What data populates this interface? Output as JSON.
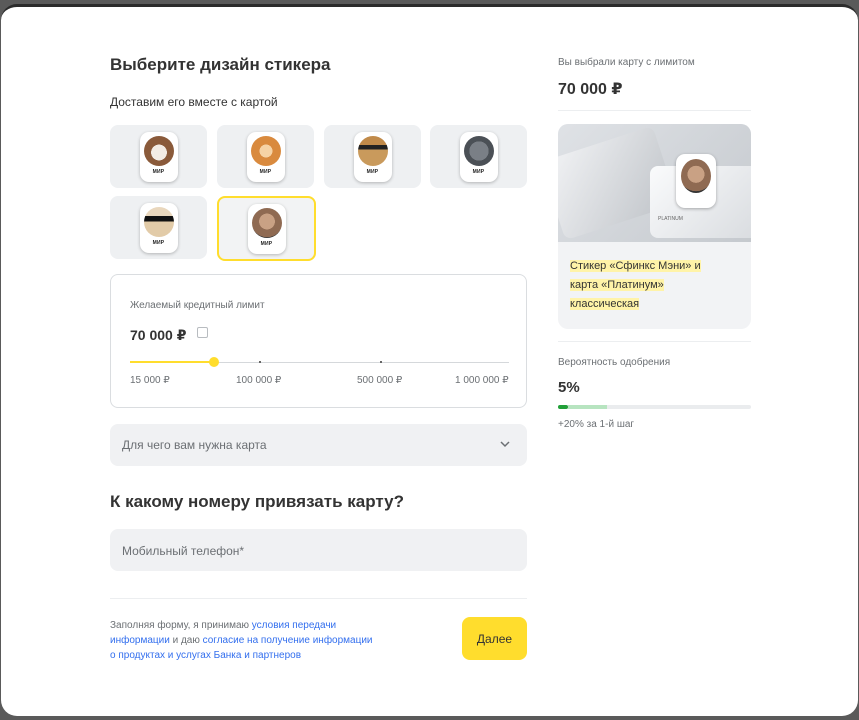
{
  "sticker_section": {
    "title": "Выберите дизайн стикера",
    "subtitle": "Доставим его вместе с картой",
    "sticker_logo": "МИР",
    "stickers": [
      {
        "animal": "bulldog"
      },
      {
        "animal": "ginger-cat"
      },
      {
        "animal": "dog-sunglasses"
      },
      {
        "animal": "grey-cat"
      },
      {
        "animal": "pug-sunglasses"
      },
      {
        "animal": "sphynx-cat",
        "selected": true
      }
    ]
  },
  "limit_box": {
    "label": "Желаемый кредитный лимит",
    "value": "70 000 ₽",
    "slider_value": 70000,
    "ticks": [
      "15 000 ₽",
      "100 000 ₽",
      "500 000 ₽",
      "1 000 000 ₽"
    ]
  },
  "purpose_select": {
    "placeholder": "Для чего вам нужна карта"
  },
  "phone_section": {
    "title": "К какому номеру привязать карту?",
    "phone_placeholder": "Мобильный телефон*"
  },
  "consent": {
    "text1": "Заполняя форму, я принимаю ",
    "link1": "условия передачи информации",
    "text2": " и даю ",
    "link2": "согласие на получение информации о продуктах и услугах Банка и партнеров"
  },
  "submit_label": "Далее",
  "summary": {
    "limit_label": "Вы выбрали карту с лимитом",
    "limit_value": "70 000 ₽",
    "card_brand": "PLATINUM",
    "card_description": "Стикер «Сфинкс Мэни» и карта «Платинум» классическая",
    "approval_label": "Вероятность одобрения",
    "approval_value": "5%",
    "approval_fraction": 0.05,
    "approval_hint": "+20% за 1-й шаг"
  },
  "colors": {
    "accent": "#ffdd2d",
    "link": "#336fee",
    "progress": "#21a038"
  }
}
